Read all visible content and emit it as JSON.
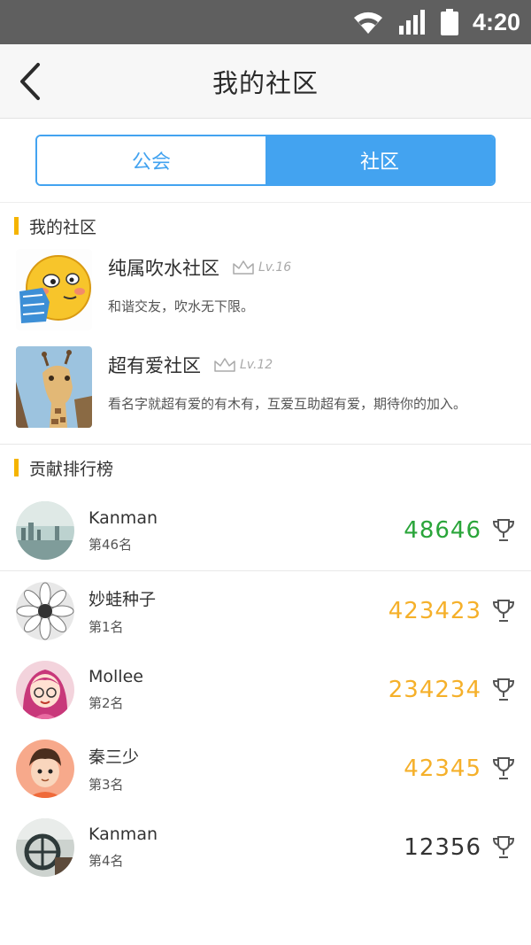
{
  "status_bar": {
    "time": "4:20"
  },
  "header": {
    "title": "我的社区"
  },
  "segments": [
    {
      "label": "公会"
    },
    {
      "label": "社区"
    }
  ],
  "my_community": {
    "title": "我的社区",
    "items": [
      {
        "name": "纯属吹水社区",
        "level": "Lv.16",
        "desc": "和谐交友，吹水无下限。"
      },
      {
        "name": "超有爱社区",
        "level": "Lv.12",
        "desc": "看名字就超有爱的有木有，互爱互助超有爱，期待你的加入。"
      }
    ]
  },
  "ranking": {
    "title": "贡献排行榜",
    "me": {
      "name": "Kanman",
      "position": "第46名",
      "score": "48646"
    },
    "list": [
      {
        "name": "妙蛙种子",
        "position": "第1名",
        "score": "423423"
      },
      {
        "name": "Mollee",
        "position": "第2名",
        "score": "234234"
      },
      {
        "name": "秦三少",
        "position": "第3名",
        "score": "42345"
      },
      {
        "name": "Kanman",
        "position": "第4名",
        "score": "12356"
      }
    ]
  },
  "colors": {
    "accent": "#43a3f0",
    "section_bar": "#f5b400",
    "score_me": "#2aa53a",
    "score_top": "#f5b02a",
    "score_normal": "#333333"
  }
}
